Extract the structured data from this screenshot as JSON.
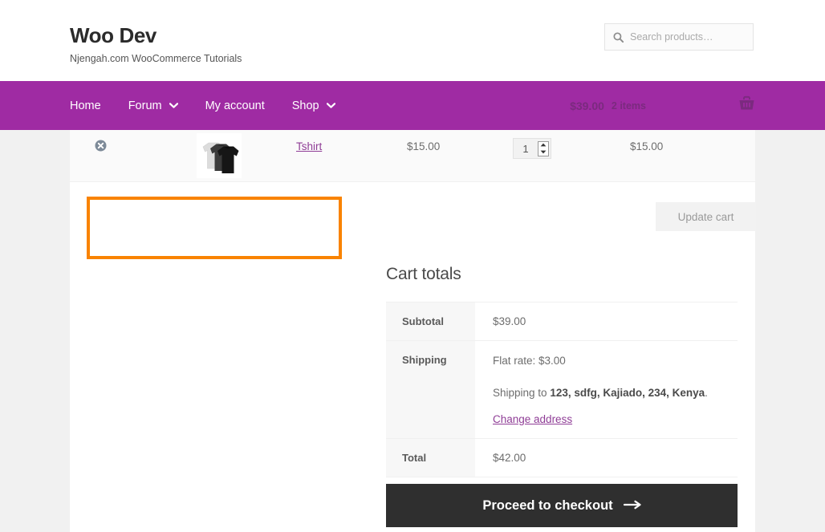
{
  "header": {
    "brand_title": "Woo Dev",
    "brand_tagline": "Njengah.com WooCommerce Tutorials",
    "search": {
      "placeholder": "Search products…",
      "value": "",
      "icon": "search-icon"
    }
  },
  "nav": {
    "background_color": "#9f2ba3",
    "items": [
      {
        "label": "Home",
        "has_dropdown": false
      },
      {
        "label": "Forum",
        "has_dropdown": true
      },
      {
        "label": "My account",
        "has_dropdown": false
      },
      {
        "label": "Shop",
        "has_dropdown": true
      }
    ],
    "cart": {
      "amount": "$39.00",
      "count": "2 items",
      "icon": "shopping-basket-icon"
    }
  },
  "cart_row": {
    "remove_icon": "remove-item-icon",
    "thumbnail_alt": "tshirt-thumbnail",
    "product_name": "Tshirt",
    "price": "$15.00",
    "quantity": "1",
    "subtotal": "$15.00"
  },
  "annotation": {
    "color": "#f98300",
    "label": ""
  },
  "actions": {
    "update_cart_label": "Update cart",
    "update_cart_disabled": true
  },
  "cart_totals": {
    "heading": "Cart totals",
    "rows": [
      {
        "label": "Subtotal",
        "value": "$39.00"
      },
      {
        "label": "Shipping",
        "value": "Flat rate: $3.00"
      },
      {
        "label": "Total",
        "value": "$42.00"
      }
    ],
    "shipping_to_prefix": "Shipping to ",
    "shipping_to_address": "123, sdfg, Kajiado, 234, Kenya",
    "shipping_to_suffix": ".",
    "change_address_label": "Change address"
  },
  "checkout": {
    "label": "Proceed to checkout",
    "arrow": "→"
  }
}
